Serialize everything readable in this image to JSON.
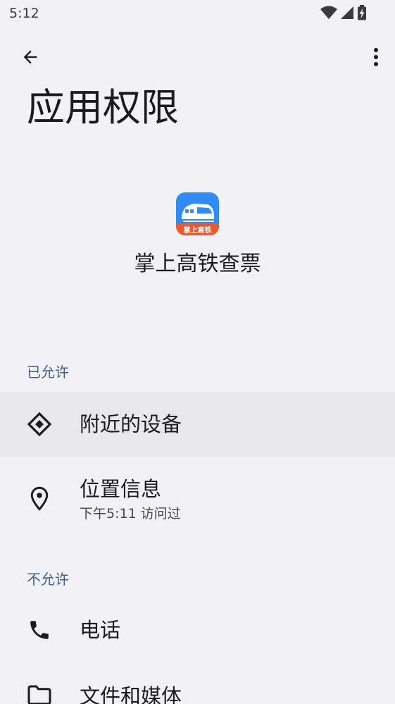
{
  "status_bar": {
    "time": "5:12"
  },
  "app_bar": {
    "back_icon": "arrow-back-icon",
    "more_icon": "more-vert-icon"
  },
  "page": {
    "title": "应用权限"
  },
  "app": {
    "name": "掌上高铁查票",
    "icon_label": "掌上高铁",
    "icon_colors": {
      "top": "#2f8bf5",
      "bottom": "#ef5a2c"
    }
  },
  "sections": {
    "allowed": {
      "header": "已允许",
      "items": [
        {
          "title": "附近的设备",
          "icon": "nearby-devices-icon"
        },
        {
          "title": "位置信息",
          "subtitle": "下午5:11 访问过",
          "icon": "location-icon"
        }
      ]
    },
    "denied": {
      "header": "不允许",
      "items": [
        {
          "title": "电话",
          "icon": "phone-icon"
        },
        {
          "title": "文件和媒体",
          "icon": "folder-icon"
        }
      ]
    }
  },
  "colors": {
    "background": "#f2f1f6",
    "section_header": "#3d5f8f",
    "highlight_row": "#e8e7ec"
  }
}
